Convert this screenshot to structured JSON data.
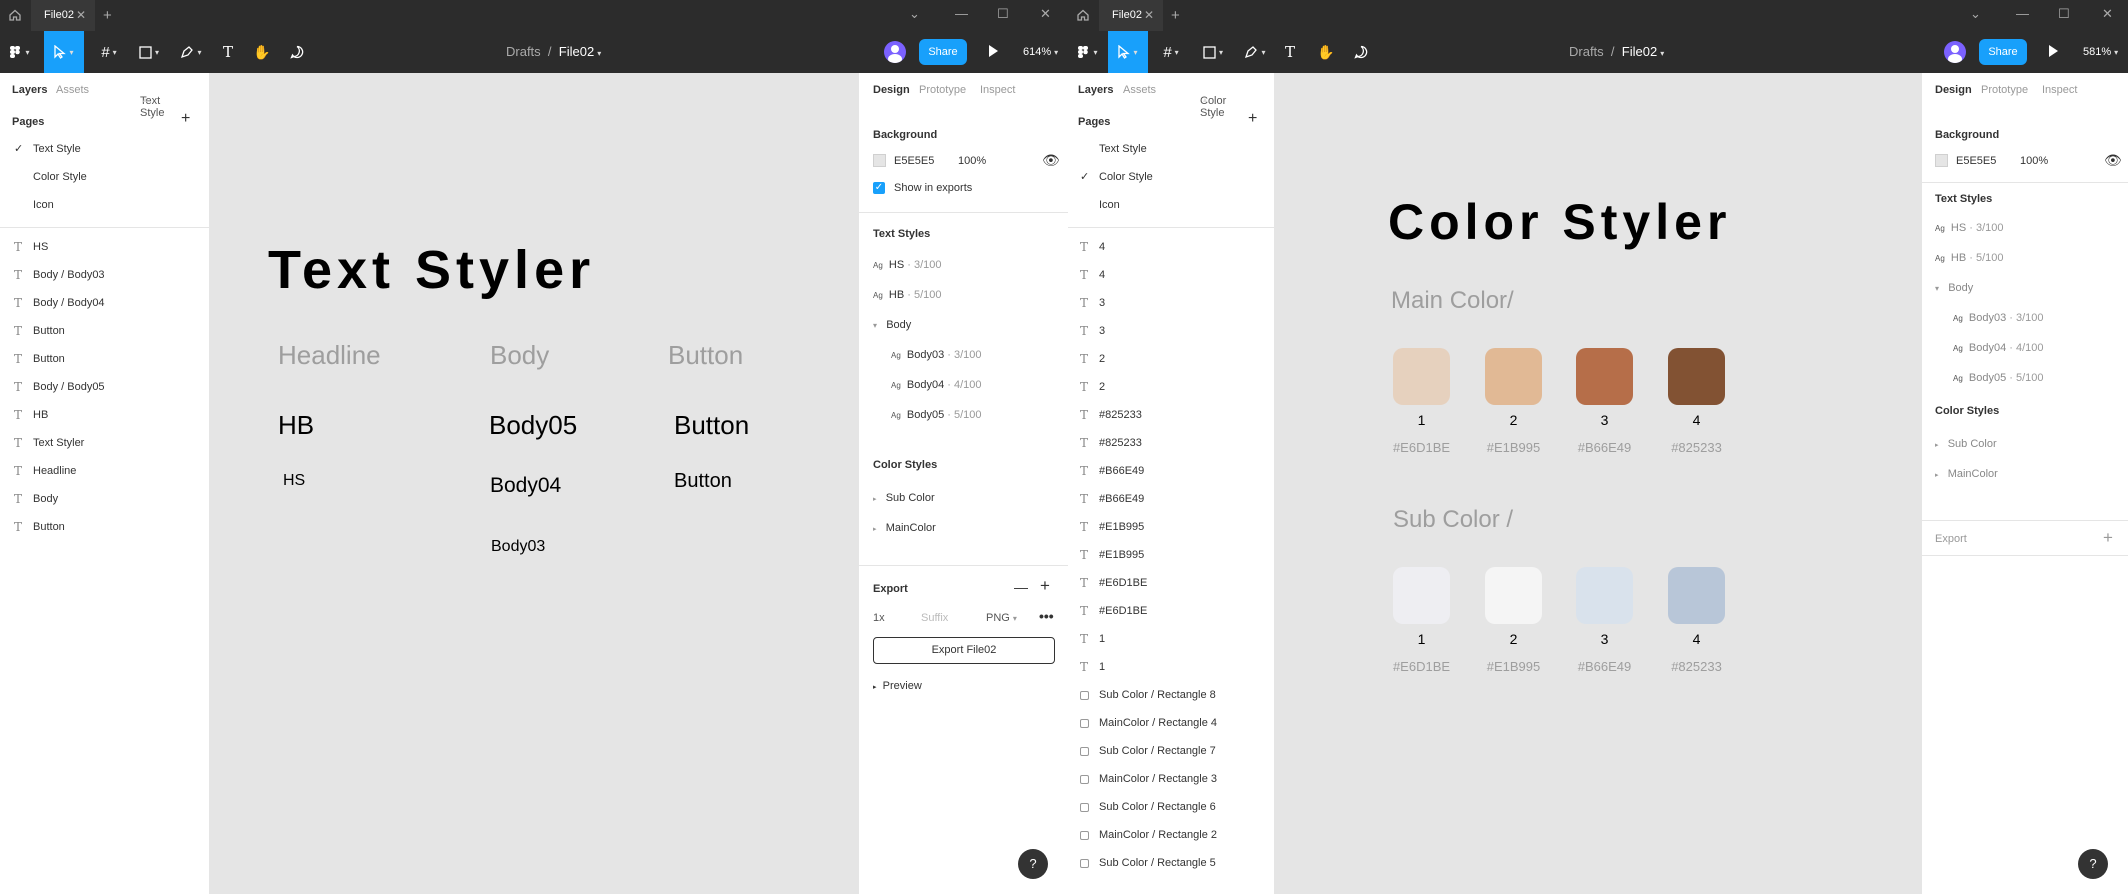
{
  "windows": [
    {
      "tab": "File02",
      "breadcrumb_parent": "Drafts",
      "breadcrumb_sep": "/",
      "file": "File02",
      "share": "Share",
      "zoom": "614%",
      "left_tabs": [
        "Layers",
        "Assets",
        "Text Style"
      ],
      "pages_label": "Pages",
      "pages": [
        "Text Style",
        "Color Style",
        "Icon"
      ],
      "current_page": 0,
      "layers": [
        "HS",
        "Body / Body03",
        "Body / Body04",
        "Button",
        "Button",
        "Body / Body05",
        "HB",
        "Text Styler",
        "Headline",
        "Body",
        "Button"
      ],
      "canvas": {
        "title": "Text Styler",
        "headers": [
          "Headline",
          "Body",
          "Button"
        ],
        "hb": "HB",
        "hs": "HS",
        "body05": "Body05",
        "body04": "Body04",
        "body03": "Body03",
        "button1": "Button",
        "button2": "Button"
      },
      "right": {
        "tabs": [
          "Design",
          "Prototype",
          "Inspect"
        ],
        "background_label": "Background",
        "bg_hex": "E5E5E5",
        "bg_opacity": "100%",
        "show_in_exports": "Show in exports",
        "text_styles_label": "Text Styles",
        "text_styles": [
          {
            "name": "HS",
            "meta": " · 3/100"
          },
          {
            "name": "HB",
            "meta": " · 5/100"
          }
        ],
        "body_group": "Body",
        "body_styles": [
          {
            "name": "Body03",
            "meta": " · 3/100"
          },
          {
            "name": "Body04",
            "meta": " · 4/100"
          },
          {
            "name": "Body05",
            "meta": " · 5/100"
          }
        ],
        "color_styles_label": "Color Styles",
        "color_styles": [
          "Sub Color",
          "MainColor"
        ],
        "export_label": "Export",
        "export_scale": "1x",
        "export_suffix": "Suffix",
        "export_format": "PNG",
        "export_button": "Export File02",
        "preview": "Preview"
      },
      "help": "?"
    },
    {
      "tab": "File02",
      "breadcrumb_parent": "Drafts",
      "breadcrumb_sep": "/",
      "file": "File02",
      "share": "Share",
      "zoom": "581%",
      "left_tabs": [
        "Layers",
        "Assets",
        "Color Style"
      ],
      "pages_label": "Pages",
      "pages": [
        "Text Style",
        "Color Style",
        "Icon"
      ],
      "current_page": 1,
      "layers": [
        {
          "k": "t",
          "n": "4"
        },
        {
          "k": "t",
          "n": "4"
        },
        {
          "k": "t",
          "n": "3"
        },
        {
          "k": "t",
          "n": "3"
        },
        {
          "k": "t",
          "n": "2"
        },
        {
          "k": "t",
          "n": "2"
        },
        {
          "k": "t",
          "n": "#825233"
        },
        {
          "k": "t",
          "n": "#825233"
        },
        {
          "k": "t",
          "n": "#B66E49"
        },
        {
          "k": "t",
          "n": "#B66E49"
        },
        {
          "k": "t",
          "n": "#E1B995"
        },
        {
          "k": "t",
          "n": "#E1B995"
        },
        {
          "k": "t",
          "n": "#E6D1BE"
        },
        {
          "k": "t",
          "n": "#E6D1BE"
        },
        {
          "k": "t",
          "n": "1"
        },
        {
          "k": "t",
          "n": "1"
        },
        {
          "k": "r",
          "n": "Sub Color / Rectangle 8"
        },
        {
          "k": "r",
          "n": "MainColor / Rectangle 4"
        },
        {
          "k": "r",
          "n": "Sub Color / Rectangle 7"
        },
        {
          "k": "r",
          "n": "MainColor / Rectangle 3"
        },
        {
          "k": "r",
          "n": "Sub Color / Rectangle 6"
        },
        {
          "k": "r",
          "n": "MainColor / Rectangle 2"
        },
        {
          "k": "r",
          "n": "Sub Color / Rectangle 5"
        }
      ],
      "canvas": {
        "title": "Color Styler",
        "main_label": "Main Color/",
        "sub_label": "Sub Color /",
        "main": [
          {
            "num": "1",
            "hex": "#E6D1BE",
            "color": "#E6D1BE"
          },
          {
            "num": "2",
            "hex": "#E1B995",
            "color": "#E1B995"
          },
          {
            "num": "3",
            "hex": "#B66E49",
            "color": "#B66E49"
          },
          {
            "num": "4",
            "hex": "#825233",
            "color": "#825233"
          }
        ],
        "sub": [
          {
            "num": "1",
            "hex": "#E6D1BE",
            "color": "#EEEEF2"
          },
          {
            "num": "2",
            "hex": "#E1B995",
            "color": "#F5F5F5"
          },
          {
            "num": "3",
            "hex": "#B66E49",
            "color": "#D9E2EC"
          },
          {
            "num": "4",
            "hex": "#825233",
            "color": "#B8C6D8"
          }
        ]
      },
      "right": {
        "tabs": [
          "Design",
          "Prototype",
          "Inspect"
        ],
        "background_label": "Background",
        "bg_hex": "E5E5E5",
        "bg_opacity": "100%",
        "text_styles_label": "Text Styles",
        "text_styles": [
          {
            "name": "HS",
            "meta": " · 3/100"
          },
          {
            "name": "HB",
            "meta": " · 5/100"
          }
        ],
        "body_group": "Body",
        "body_styles": [
          {
            "name": "Body03",
            "meta": " · 3/100"
          },
          {
            "name": "Body04",
            "meta": " · 4/100"
          },
          {
            "name": "Body05",
            "meta": " · 5/100"
          }
        ],
        "color_styles_label": "Color Styles",
        "color_styles": [
          "Sub Color",
          "MainColor"
        ],
        "export_label": "Export"
      },
      "help": "?"
    }
  ],
  "colors": {
    "accent": "#18a0fb",
    "dark": "#2c2c2c",
    "canvas": "#E5E5E5"
  }
}
